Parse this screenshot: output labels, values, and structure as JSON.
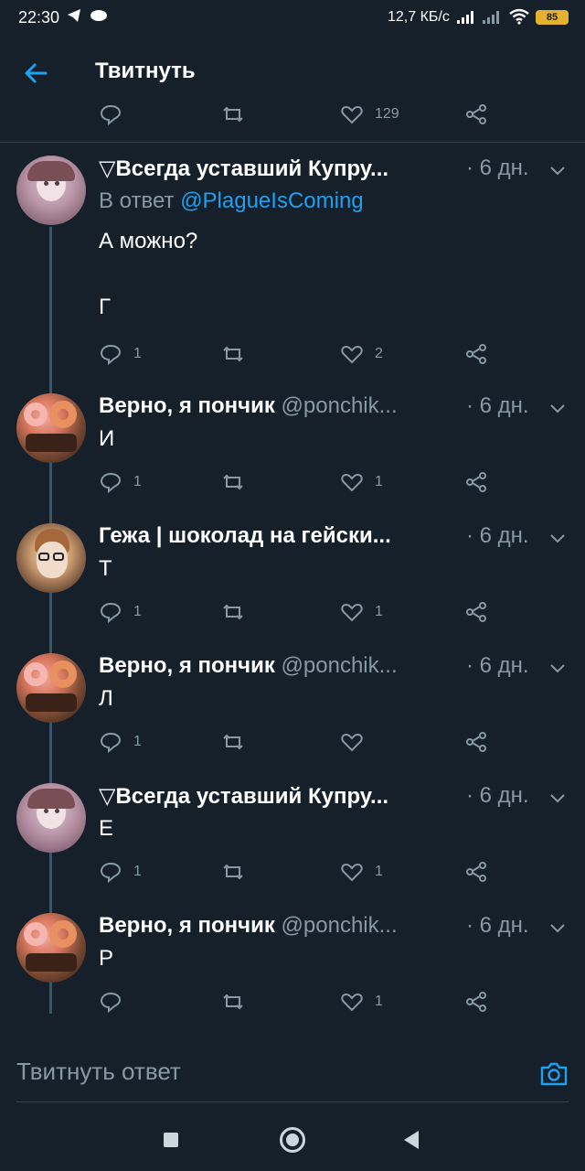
{
  "status_bar": {
    "time": "22:30",
    "speed": "12,7 КБ/с",
    "battery": "85"
  },
  "header": {
    "title": "Твитнуть"
  },
  "top_actions": {
    "like_count": "129"
  },
  "tweets": [
    {
      "name": "▽Всегда уставший Купру...",
      "handle": "",
      "time": "· 6 дн.",
      "reply_prefix": "В ответ ",
      "reply_mention": "@PlagueIsComing",
      "text": "А можно?\n\nГ",
      "reply_count": "1",
      "retweet_count": "",
      "like_count": "2"
    },
    {
      "name": "Верно, я пончик",
      "handle": "@ponchik...",
      "time": "· 6 дн.",
      "text": "И",
      "reply_count": "1",
      "retweet_count": "",
      "like_count": "1"
    },
    {
      "name": "Гежа | шоколад на гейски...",
      "handle": "",
      "time": "· 6 дн.",
      "text": "Т",
      "reply_count": "1",
      "retweet_count": "",
      "like_count": "1"
    },
    {
      "name": "Верно, я пончик",
      "handle": "@ponchik...",
      "time": "· 6 дн.",
      "text": "Л",
      "reply_count": "1",
      "retweet_count": "",
      "like_count": ""
    },
    {
      "name": "▽Всегда уставший Купру...",
      "handle": "",
      "time": "· 6 дн.",
      "text": "Е",
      "reply_count": "1",
      "retweet_count": "",
      "like_count": "1"
    },
    {
      "name": "Верно, я пончик",
      "handle": "@ponchik...",
      "time": "· 6 дн.",
      "text": "Р",
      "reply_count": "",
      "retweet_count": "",
      "like_count": "1"
    }
  ],
  "compose": {
    "placeholder": "Твитнуть ответ"
  },
  "colors": {
    "background": "#15202b",
    "secondary_text": "#8899a6",
    "link": "#1da1f2",
    "divider": "#38444d"
  }
}
